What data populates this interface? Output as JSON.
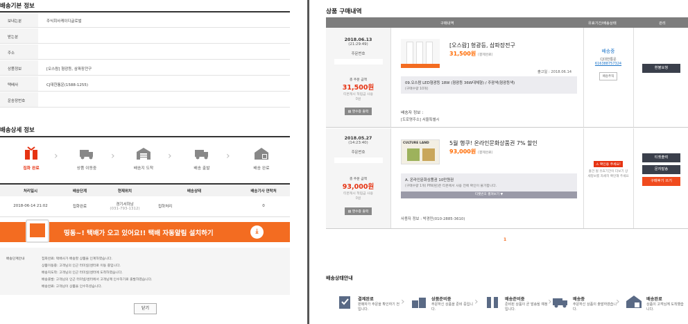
{
  "left": {
    "basic_title": "배송기본 정보",
    "basic_rows": [
      {
        "k": "보내는분",
        "v": "주식회사케이디글로벌"
      },
      {
        "k": "받는분",
        "v": ""
      },
      {
        "k": "주소",
        "v": ""
      },
      {
        "k": "상품정보",
        "v": "[오스람] 형광등, 삼파장전구"
      },
      {
        "k": "택배사",
        "v": "CJ대한통운(1588-1255)"
      },
      {
        "k": "운송장번호",
        "v": ""
      }
    ],
    "detail_title": "배송상세 정보",
    "steps": [
      "집화 완료",
      "상품 이동중",
      "배송지 도착",
      "배송 출발",
      "배송 완료"
    ],
    "table_headers": [
      "처리일시",
      "배송단계",
      "현재위치",
      "배송상태",
      "배송기사 연락처"
    ],
    "table_row": {
      "date": "2018-06-14 21:02",
      "stage": "집화완료",
      "loc": "경기서하남",
      "loc2": "(031-793-1312)",
      "status": "집하처리",
      "contact": "0"
    },
    "banner": "띵동~! 택배가 오고 있어요!! 택배 자동알림 설치하기",
    "banner_icon": "download-icon",
    "guide_label": "배송단계안내",
    "guide_lines": [
      "집화완료: 택배사가 배송할 상품을 인계하였습니다.",
      "상품이동중: 고객님의 인근 터미널/센터로 이동 중입니다.",
      "배송지도착: 고객님의 인근 터미널/센터에 도착하였습니다.",
      "배송출발: 고객님의 인근 터미널/센터에서 고객님께 인수하기로 출발하였습니다.",
      "배송완료: 고객님이 상품을 인수하셨습니다."
    ],
    "close": "닫기"
  },
  "right": {
    "title": "상품 구매내역",
    "headers": [
      "구매내역",
      "유효기간/배송상태",
      "관리"
    ],
    "orders": [
      {
        "date": "2018.06.13",
        "time": "(21:29:49)",
        "order_no_label": "주문번호",
        "total_label": "총 주문 금액",
        "total": "31,500원",
        "points": "티몬캐시 적립금 사용",
        "points_val": "0원",
        "receipt": "영수증 출력",
        "product": "[오스람] 형광등, 삼파장전구",
        "price": "31,500원",
        "pay": "(결제완료)",
        "release": "출고일 : 2018.06.14",
        "option": "09.오스람 LED형광등 18W (형광등 36W대체형) / 주광색(형광등색)",
        "qty": "(구매수량 10개)",
        "status": "배송중",
        "courier": "CJ대한통운",
        "tracking": "616388757324",
        "track_btn": "배송추적",
        "action": "환불요청",
        "recv_label": "배송자 정보 :",
        "addr": "[도로명주소] 서울특별시"
      },
      {
        "date": "2018.05.27",
        "time": "(14:23:40)",
        "order_no_label": "주문번호",
        "total_label": "총 주문 금액",
        "total": "93,000원",
        "points": "티몬캐시 적립금 사용",
        "points_val": "0원",
        "receipt": "영수증 출력",
        "product": "5월 행쿠! 온라인문화상품권 7% 할인",
        "price": "93,000원",
        "pay": "(결제완료)",
        "brand": "CULTURE LAND",
        "option": "A. 온라인문화상품권 10만원권",
        "qty": "(구매수량 1개)",
        "notice": "PIN(핀)은 티몬에서 사용 전에 확인이 불가합니다.",
        "more": "티켓번호 펼쳐보기 ▼",
        "status_badge": "확인용 주세요!",
        "status_desc": "출건 될 유효기간이 더보기 상세정보를 자세히 확인해 주세요",
        "actions": [
          "티켓출력",
          "문자발송",
          "구매후기 쓰기"
        ],
        "recv": "사용자 정보 : 박경민(010-2885-3610)"
      }
    ],
    "page": "1",
    "guide_title": "배송상태안내",
    "guide_steps": [
      {
        "t": "결제완료",
        "d": "판매자가 주문을 확인하기 전입니다."
      },
      {
        "t": "상품준비중",
        "d": "주문하신 상품을 준비 중입니다."
      },
      {
        "t": "배송준비중",
        "d": "준비된 상품이 곧 발송될 예정입니다."
      },
      {
        "t": "배송중",
        "d": "주문하신 상품이 출발하였습니다."
      },
      {
        "t": "배송완료",
        "d": "상품이 고객님께 도착했습니다."
      }
    ]
  },
  "colors": {
    "accent": "#f36c21",
    "red": "#e63312",
    "dark": "#3a3f4b"
  }
}
